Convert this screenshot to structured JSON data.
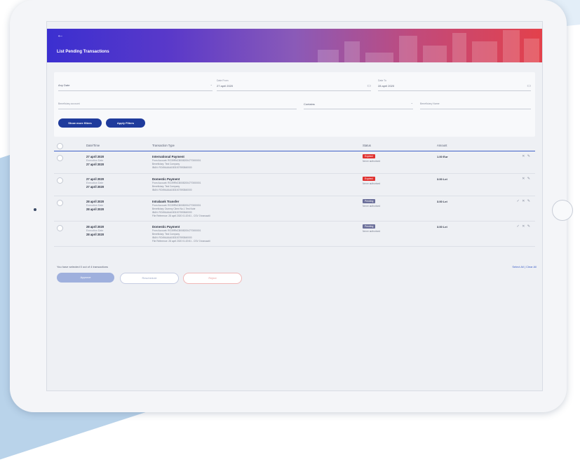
{
  "header": {
    "back_label": "←",
    "title": "List Pending Transactions"
  },
  "filters": {
    "any_date": {
      "value": "Any Date"
    },
    "date_from": {
      "label": "Date From",
      "value": "27 april 2020"
    },
    "date_to": {
      "label": "Date To",
      "value": "28 april 2020"
    },
    "beneficiary_account": {
      "placeholder": "Beneficiary account"
    },
    "contains": {
      "value": "Contains"
    },
    "beneficiary_name": {
      "placeholder": "Beneficiary Name"
    },
    "show_more_label": "Show more filters",
    "apply_label": "Apply Filters",
    "calendar_icon": "calendar-icon",
    "dropdown_icon": "chevron-down-icon"
  },
  "table": {
    "columns": [
      "Date/Time",
      "Transaction Type",
      "Status",
      "Amount"
    ],
    "rows": [
      {
        "date": "27 april 2020",
        "exec_label": "Execution Date",
        "exec_date": "27 april 2020",
        "type": "International Payment",
        "lines": [
          "From Account: RO39RNCB0082004770000001",
          "Beneficiary: Test Company",
          "IBAN: RO49AAAA1B31007593840000"
        ],
        "status": "Expired",
        "status_color": "#e0312f",
        "status_sub": "Never authorised",
        "amount": "1.00 Eur",
        "actions": "✕ ✎"
      },
      {
        "date": "27 april 2020",
        "exec_label": "Execution Date",
        "exec_date": "27 april 2020",
        "type": "Domestic Payment",
        "lines": [
          "From Account: RO39RNCB0082004770000001",
          "Beneficiary: Test Company",
          "IBAN: RO49AAAA1B31007593840000"
        ],
        "status": "Expired",
        "status_color": "#e0312f",
        "status_sub": "Never authorised",
        "amount": "3.00 Lei",
        "actions": "✕ ✎"
      },
      {
        "date": "28 april 2020",
        "exec_label": "Execution Date",
        "exec_date": "28 april 2020",
        "type": "Intrabank Transfer",
        "lines": [
          "From Account: RO39RNCB0082004770000001",
          "Beneficiary: Dummy Client No.1 Test Note",
          "IBAN: RO49AAAA1B31007593840000",
          "File Reference: 28 april 2020 01:20:51 - CSV 3 transactii"
        ],
        "status": "Pending",
        "status_color": "#6b6f9a",
        "status_sub": "Never authorised",
        "amount": "3.00 Lei",
        "actions": "✓ ✕ ✎"
      },
      {
        "date": "28 april 2020",
        "exec_label": "Execution Date",
        "exec_date": "28 april 2020",
        "type": "Domestic Payment",
        "lines": [
          "From Account: RO39RNCB0082004770000001",
          "Beneficiary: Test Company",
          "IBAN: RO49AAAA1B31007593840000",
          "File Reference: 28 april 2020 01:20:51 - CSV 3 transactii"
        ],
        "status": "Pending",
        "status_color": "#6b6f9a",
        "status_sub": "Never authorised",
        "amount": "3.00 Lei",
        "actions": "✓ ✕ ✎"
      }
    ]
  },
  "footer": {
    "selection_note": "You have selected 0 out of 4 transactions",
    "select_all": "Select All",
    "separator": "|",
    "clear_all": "Clear All",
    "approve_label": "Approve",
    "reschedule_label": "Reschedule",
    "reject_label": "Reject"
  },
  "colors": {
    "primary": "#1f3b9c",
    "expired": "#e0312f",
    "pending": "#6b6f9a",
    "header_start": "#3b2fd0",
    "header_end": "#e3414b"
  }
}
